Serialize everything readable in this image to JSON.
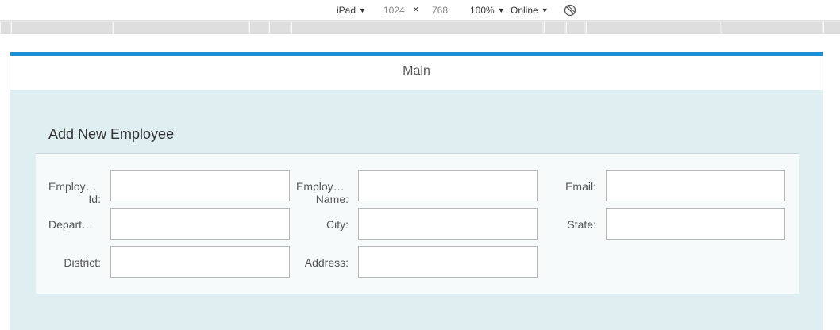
{
  "devtools": {
    "device": "iPad",
    "width": "1024",
    "times": "×",
    "height": "768",
    "zoom": "100%",
    "network": "Online",
    "dropdown_arrow": "▼",
    "rotate_icon": "rotate-icon"
  },
  "app": {
    "header_title": "Main",
    "accent_color": "#1a8fd8",
    "background_color": "#dfeef1"
  },
  "form": {
    "title": "Add New Employee",
    "fields": [
      {
        "label_line1": "Employ…",
        "label_line2": "Id:",
        "value": ""
      },
      {
        "label_line1": "Employ…",
        "label_line2": "Name:",
        "value": ""
      },
      {
        "label_line1": "Email:",
        "label_line2": "",
        "value": ""
      },
      {
        "label_line1": "Depart…",
        "label_line2": "",
        "value": ""
      },
      {
        "label_line1": "City:",
        "label_line2": "",
        "value": ""
      },
      {
        "label_line1": "State:",
        "label_line2": "",
        "value": ""
      },
      {
        "label_line1": "District:",
        "label_line2": "",
        "value": ""
      },
      {
        "label_line1": "Address:",
        "label_line2": "",
        "value": ""
      }
    ]
  }
}
